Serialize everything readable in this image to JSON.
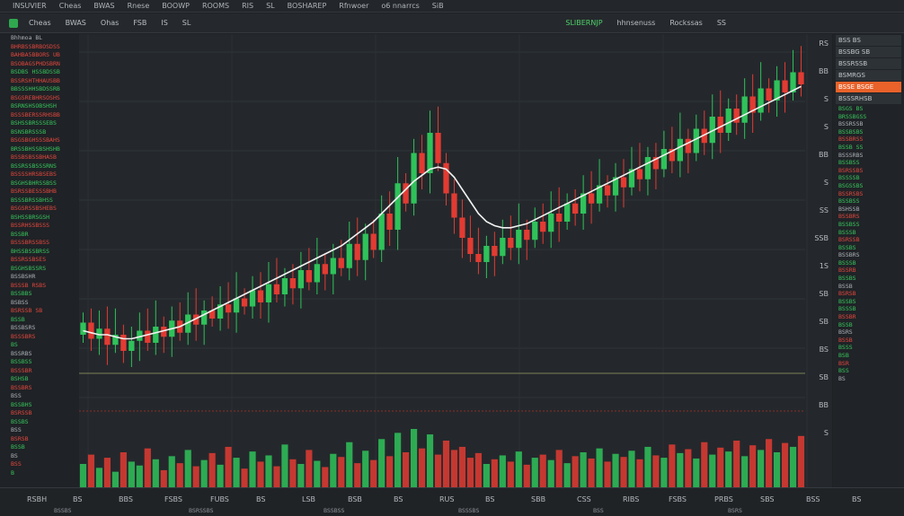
{
  "topbar": {
    "items": [
      "INSUVIER",
      "Cheas",
      "BWAS",
      "Rnese",
      "BOOWP",
      "ROOMS",
      "RIS",
      "SL",
      "BOSHAREP",
      "Rfnwoer",
      "o6 nnarrcs",
      "SiB"
    ]
  },
  "toolbar": {
    "tools": [
      "Cheas",
      "BWAS",
      "Ohas",
      "FSB",
      "IS",
      "SL"
    ],
    "symbol": "SLIBERNJP",
    "right_tools": [
      "hhnsenuss",
      "Rockssas",
      "SS"
    ]
  },
  "left_panel": {
    "rows": [
      {
        "t": "Bhhmoa BL",
        "s": "neutral"
      },
      {
        "t": "BHRBSSBRBOSDSS",
        "s": "down"
      },
      {
        "t": "BAHBA5BBORS UB",
        "s": "down"
      },
      {
        "t": "BSOBAGSPHDSBRN",
        "s": "down"
      },
      {
        "t": "BSDBS HSSBDSSB",
        "s": "up"
      },
      {
        "t": "BSSRSHTHHAUSBB",
        "s": "down"
      },
      {
        "t": "BBSSSHHSBDSSRB",
        "s": "up"
      },
      {
        "t": "BSGSREBHRSOSHS",
        "s": "down"
      },
      {
        "t": "BSRNSHSOBSHSH",
        "s": "up"
      },
      {
        "t": "BSSSBERSSRHSBB",
        "s": "down"
      },
      {
        "t": "BSHSSBRSSSEBS",
        "s": "up"
      },
      {
        "t": "BSNSBRSSSB",
        "s": "up"
      },
      {
        "t": "BSGSBGHSSSBAHS",
        "s": "down"
      },
      {
        "t": "BRSSBHSSBSHSHB",
        "s": "up"
      },
      {
        "t": "BSSBSBSSBHASB",
        "s": "down"
      },
      {
        "t": "BSSRSSBSSSRNS",
        "s": "up"
      },
      {
        "t": "BSSSSHRSBSEBS",
        "s": "down"
      },
      {
        "t": "BSGHSBHRSSBSS",
        "s": "up"
      },
      {
        "t": "BSRSSBESSSBHB",
        "s": "down"
      },
      {
        "t": "BSSSBRSSBHSS",
        "s": "up"
      },
      {
        "t": "BSGSRSSBSHEBS",
        "s": "down"
      },
      {
        "t": "BSHSSBRSGSH",
        "s": "up"
      },
      {
        "t": "BSSRHSSBSSS",
        "s": "down"
      },
      {
        "t": "BSSBR",
        "s": "up"
      },
      {
        "t": "BSSSBRSSBSS",
        "s": "down"
      },
      {
        "t": "BHSSBSSBRSS",
        "s": "up"
      },
      {
        "t": "BSSRSSBSES",
        "s": "down"
      },
      {
        "t": "BSGHSBSSRS",
        "s": "up"
      },
      {
        "t": "BSSBSHR",
        "s": "neutral"
      },
      {
        "t": "BSSSB RSBS",
        "s": "down"
      },
      {
        "t": "BSSBBS",
        "s": "up"
      },
      {
        "t": "BSBSS",
        "s": "neutral"
      },
      {
        "t": "BSRSSB SB",
        "s": "down"
      },
      {
        "t": "BSSB",
        "s": "up"
      },
      {
        "t": "BSSBSRS",
        "s": "neutral"
      },
      {
        "t": "BSSSBRS",
        "s": "down"
      },
      {
        "t": "BS",
        "s": "up"
      },
      {
        "t": "BSSRBS",
        "s": "neutral"
      },
      {
        "t": "BSSBSS",
        "s": "up"
      },
      {
        "t": "BSSSBR",
        "s": "down"
      },
      {
        "t": "BSHSB",
        "s": "up"
      },
      {
        "t": "BSSBRS",
        "s": "down"
      },
      {
        "t": "BSS",
        "s": "neutral"
      },
      {
        "t": "BSSBHS",
        "s": "up"
      },
      {
        "t": "BSRSSB",
        "s": "down"
      },
      {
        "t": "BSSBS",
        "s": "up"
      },
      {
        "t": "BSS",
        "s": "neutral"
      },
      {
        "t": "BSRSB",
        "s": "down"
      },
      {
        "t": "BSSB",
        "s": "up"
      },
      {
        "t": "BS",
        "s": "neutral"
      },
      {
        "t": "BSS",
        "s": "down"
      },
      {
        "t": "B",
        "s": "up"
      }
    ]
  },
  "price_axis": {
    "labels": [
      "RS",
      "BB",
      "S",
      "S",
      "BB",
      "S",
      "SS",
      "SSB",
      "1S",
      "SB",
      "SB",
      "BS",
      "SB",
      "BB",
      "S"
    ]
  },
  "right_panel": {
    "tabs": [
      {
        "t": "BSS  BS",
        "orange": false
      },
      {
        "t": "BSSBG SB",
        "orange": false
      },
      {
        "t": "BSSRSSB",
        "orange": false
      },
      {
        "t": "BSMRGS",
        "orange": false
      },
      {
        "t": "BSSE BSGE",
        "orange": true
      },
      {
        "t": "BSSSRHSB",
        "orange": false
      }
    ],
    "rows": [
      {
        "t": "BSGS  BS",
        "s": "up"
      },
      {
        "t": "BRSSBGSS",
        "s": "up"
      },
      {
        "t": "BSSRSSB",
        "s": "neutral"
      },
      {
        "t": "BSSBSBS",
        "s": "up"
      },
      {
        "t": "BSSBRSS",
        "s": "down"
      },
      {
        "t": "BSSB  SS",
        "s": "up"
      },
      {
        "t": "BSSSRBS",
        "s": "neutral"
      },
      {
        "t": "BSSBSS",
        "s": "up"
      },
      {
        "t": "BSRSSBS",
        "s": "down"
      },
      {
        "t": "BSSSSB",
        "s": "up"
      },
      {
        "t": "BSGSSBS",
        "s": "up"
      },
      {
        "t": "BSSRSBS",
        "s": "down"
      },
      {
        "t": "BSSBSS",
        "s": "up"
      },
      {
        "t": "BSHSSB",
        "s": "neutral"
      },
      {
        "t": "BSSBRS",
        "s": "down"
      },
      {
        "t": "BSSBSS",
        "s": "up"
      },
      {
        "t": "BSSSB",
        "s": "up"
      },
      {
        "t": "BSRSSB",
        "s": "down"
      },
      {
        "t": "BSSBS",
        "s": "up"
      },
      {
        "t": "BSSBRS",
        "s": "neutral"
      },
      {
        "t": "BSSSB",
        "s": "up"
      },
      {
        "t": "BSSRB",
        "s": "down"
      },
      {
        "t": "BSSBS",
        "s": "up"
      },
      {
        "t": "BSSB",
        "s": "neutral"
      },
      {
        "t": "BSRSB",
        "s": "down"
      },
      {
        "t": "BSSBS",
        "s": "up"
      },
      {
        "t": "BSSSB",
        "s": "up"
      },
      {
        "t": "BSSBR",
        "s": "down"
      },
      {
        "t": "BSSB",
        "s": "up"
      },
      {
        "t": "BSRS",
        "s": "neutral"
      },
      {
        "t": "BSSB",
        "s": "down"
      },
      {
        "t": "BSSS",
        "s": "up"
      },
      {
        "t": "BSB",
        "s": "up"
      },
      {
        "t": "BSR",
        "s": "down"
      },
      {
        "t": "BSS",
        "s": "up"
      },
      {
        "t": "BS",
        "s": "neutral"
      }
    ]
  },
  "time_axis": {
    "labels": [
      "RSBH",
      "BS",
      "BBS",
      "FSBS",
      "FUBS",
      "BS",
      "LSB",
      "BSB",
      "BS",
      "RUS",
      "BS",
      "SBB",
      "CSS",
      "RIBS",
      "FSBS",
      "PRBS",
      "SBS",
      "BSS",
      "BS"
    ],
    "sublabels": [
      "BSSBS",
      "BSRSSBS",
      "BSSBSS",
      "BSSSBS",
      "BSS",
      "BSRS"
    ]
  },
  "colors": {
    "bull": "#2fc25a",
    "bear": "#e23b32",
    "ma_line": "#f2f2f2",
    "accent_orange": "#e8622a",
    "background": "#24282c"
  },
  "chart_data": {
    "type": "candlestick",
    "title": "",
    "xlabel": "",
    "ylabel": "",
    "trend_shape": "uptrend with pullback mid-session then strong recovery",
    "candles": [
      {
        "o": 60,
        "c": 66
      },
      {
        "o": 66,
        "c": 58
      },
      {
        "o": 58,
        "c": 63
      },
      {
        "o": 63,
        "c": 55
      },
      {
        "o": 55,
        "c": 60
      },
      {
        "o": 60,
        "c": 52
      },
      {
        "o": 52,
        "c": 57
      },
      {
        "o": 57,
        "c": 62
      },
      {
        "o": 62,
        "c": 56
      },
      {
        "o": 56,
        "c": 64
      },
      {
        "o": 64,
        "c": 59
      },
      {
        "o": 59,
        "c": 67
      },
      {
        "o": 67,
        "c": 61
      },
      {
        "o": 61,
        "c": 70
      },
      {
        "o": 70,
        "c": 65
      },
      {
        "o": 65,
        "c": 72
      },
      {
        "o": 72,
        "c": 68
      },
      {
        "o": 68,
        "c": 75
      },
      {
        "o": 75,
        "c": 71
      },
      {
        "o": 71,
        "c": 78
      },
      {
        "o": 78,
        "c": 74
      },
      {
        "o": 74,
        "c": 82
      },
      {
        "o": 82,
        "c": 76
      },
      {
        "o": 76,
        "c": 85
      },
      {
        "o": 85,
        "c": 80
      },
      {
        "o": 80,
        "c": 88
      },
      {
        "o": 88,
        "c": 83
      },
      {
        "o": 83,
        "c": 92
      },
      {
        "o": 92,
        "c": 86
      },
      {
        "o": 86,
        "c": 95
      },
      {
        "o": 95,
        "c": 90
      },
      {
        "o": 90,
        "c": 98
      },
      {
        "o": 98,
        "c": 93
      },
      {
        "o": 93,
        "c": 105
      },
      {
        "o": 105,
        "c": 97
      },
      {
        "o": 97,
        "c": 110
      },
      {
        "o": 110,
        "c": 102
      },
      {
        "o": 102,
        "c": 120
      },
      {
        "o": 120,
        "c": 112
      },
      {
        "o": 112,
        "c": 135
      },
      {
        "o": 135,
        "c": 125
      },
      {
        "o": 125,
        "c": 150
      },
      {
        "o": 150,
        "c": 140
      },
      {
        "o": 140,
        "c": 160
      },
      {
        "o": 160,
        "c": 145
      },
      {
        "o": 145,
        "c": 130
      },
      {
        "o": 130,
        "c": 118
      },
      {
        "o": 118,
        "c": 108
      },
      {
        "o": 108,
        "c": 100
      },
      {
        "o": 100,
        "c": 96
      },
      {
        "o": 96,
        "c": 104
      },
      {
        "o": 104,
        "c": 99
      },
      {
        "o": 99,
        "c": 108
      },
      {
        "o": 108,
        "c": 103
      },
      {
        "o": 103,
        "c": 112
      },
      {
        "o": 112,
        "c": 107
      },
      {
        "o": 107,
        "c": 116
      },
      {
        "o": 116,
        "c": 111
      },
      {
        "o": 111,
        "c": 120
      },
      {
        "o": 120,
        "c": 116
      },
      {
        "o": 116,
        "c": 125
      },
      {
        "o": 125,
        "c": 120
      },
      {
        "o": 120,
        "c": 130
      },
      {
        "o": 130,
        "c": 125
      },
      {
        "o": 125,
        "c": 134
      },
      {
        "o": 134,
        "c": 129
      },
      {
        "o": 129,
        "c": 138
      },
      {
        "o": 138,
        "c": 133
      },
      {
        "o": 133,
        "c": 142
      },
      {
        "o": 142,
        "c": 137
      },
      {
        "o": 137,
        "c": 148
      },
      {
        "o": 148,
        "c": 142
      },
      {
        "o": 142,
        "c": 152
      },
      {
        "o": 152,
        "c": 146
      },
      {
        "o": 146,
        "c": 157
      },
      {
        "o": 157,
        "c": 150
      },
      {
        "o": 150,
        "c": 162
      },
      {
        "o": 162,
        "c": 155
      },
      {
        "o": 155,
        "c": 168
      },
      {
        "o": 168,
        "c": 160
      },
      {
        "o": 160,
        "c": 172
      },
      {
        "o": 172,
        "c": 165
      },
      {
        "o": 165,
        "c": 178
      },
      {
        "o": 178,
        "c": 170
      },
      {
        "o": 170,
        "c": 182
      },
      {
        "o": 182,
        "c": 176
      },
      {
        "o": 176,
        "c": 186
      },
      {
        "o": 186,
        "c": 180
      },
      {
        "o": 180,
        "c": 190
      },
      {
        "o": 190,
        "c": 184
      }
    ],
    "ma": [
      62,
      61,
      60,
      60,
      59,
      58,
      58,
      59,
      60,
      61,
      62,
      63,
      64,
      66,
      68,
      70,
      72,
      74,
      76,
      78,
      80,
      82,
      84,
      86,
      88,
      90,
      92,
      94,
      96,
      98,
      100,
      102,
      104,
      107,
      110,
      113,
      116,
      120,
      124,
      128,
      132,
      136,
      139,
      142,
      143,
      142,
      138,
      132,
      126,
      120,
      116,
      114,
      113,
      113,
      114,
      115,
      117,
      119,
      121,
      123,
      125,
      127,
      129,
      131,
      133,
      135,
      137,
      139,
      141,
      143,
      145,
      147,
      149,
      151,
      153,
      155,
      157,
      159,
      161,
      163,
      165,
      167,
      169,
      171,
      173,
      175,
      177,
      179,
      181,
      183
    ],
    "ylim": [
      40,
      200
    ],
    "volume": [
      30,
      42,
      25,
      38,
      20,
      45,
      33,
      28,
      50,
      36,
      22,
      40,
      31,
      48,
      27,
      35,
      44,
      29,
      52,
      38,
      24,
      46,
      33,
      41,
      27,
      55,
      36,
      30,
      48,
      34,
      26,
      43,
      39,
      58,
      31,
      47,
      35,
      62,
      40,
      70,
      45,
      75,
      50,
      68,
      42,
      60,
      48,
      52,
      38,
      44,
      30,
      36,
      41,
      33,
      46,
      29,
      38,
      42,
      35,
      48,
      31,
      40,
      45,
      37,
      50,
      33,
      43,
      39,
      47,
      36,
      52,
      41,
      38,
      55,
      44,
      49,
      37,
      58,
      42,
      51,
      46,
      60,
      40,
      54,
      48,
      62,
      45,
      57,
      52,
      66
    ]
  }
}
